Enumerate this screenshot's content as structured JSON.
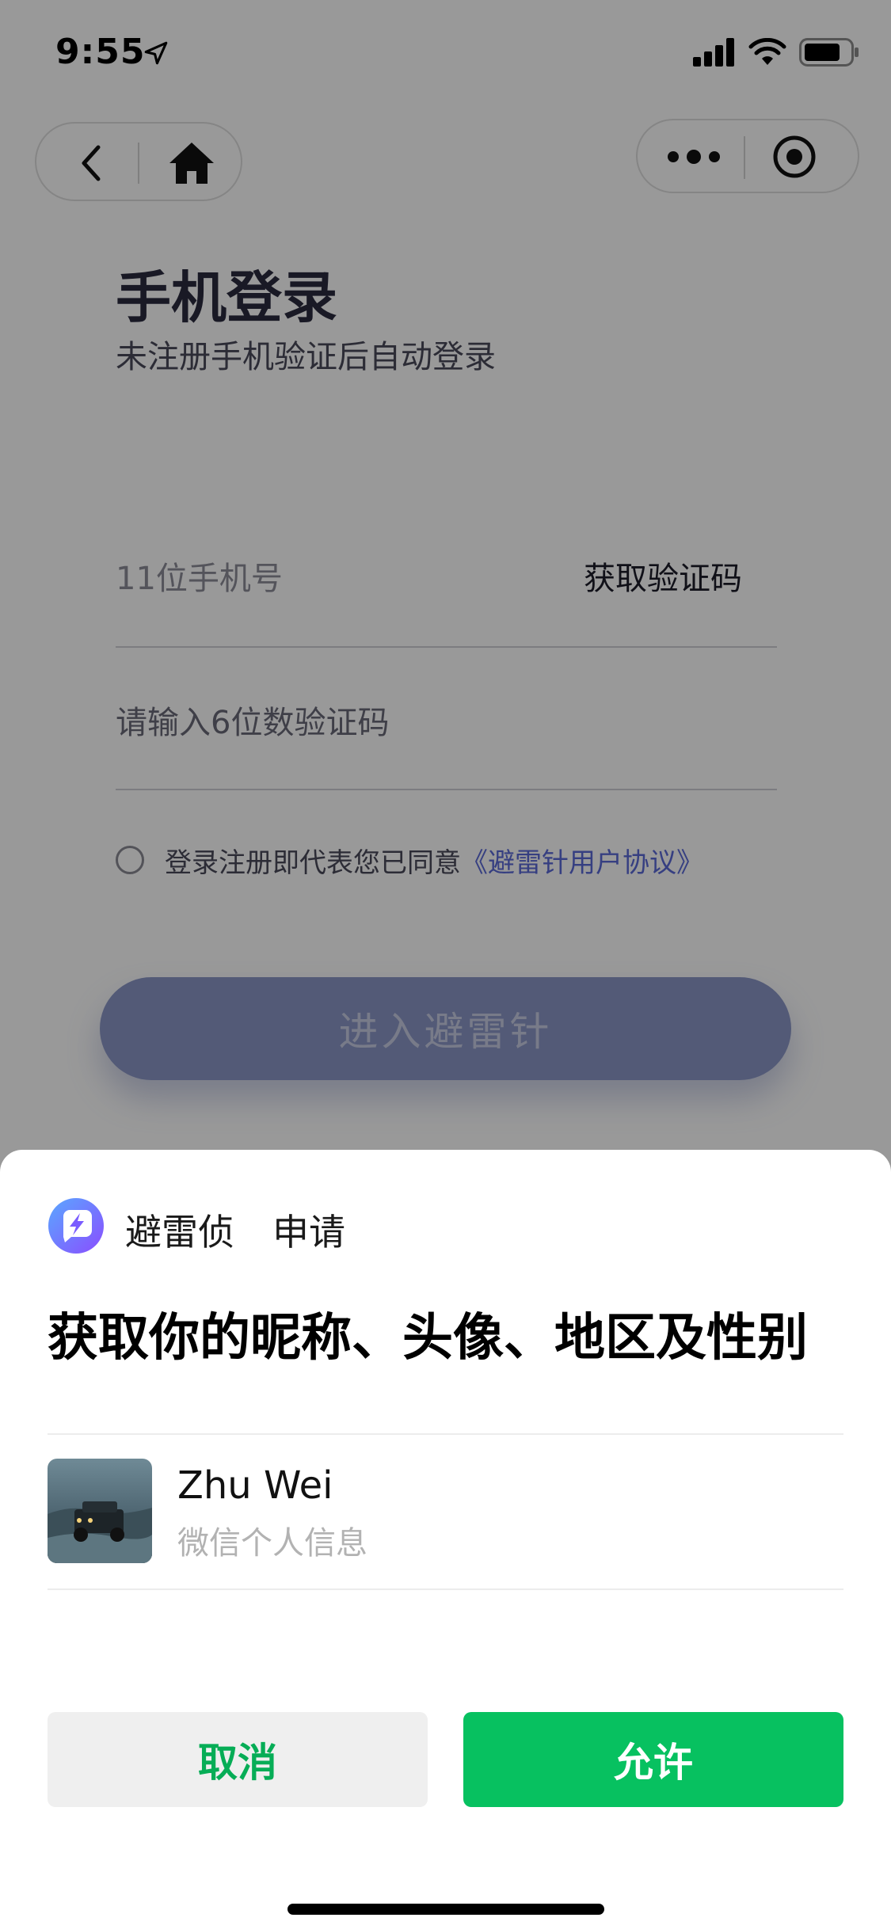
{
  "status_bar": {
    "time": "9:55",
    "icons": [
      "location-arrow-icon",
      "cellular-signal-icon",
      "wifi-icon",
      "battery-icon"
    ]
  },
  "nav": {
    "icons": [
      "back-icon",
      "home-icon",
      "more-icon",
      "target-icon"
    ]
  },
  "login": {
    "title": "手机登录",
    "subtitle": "未注册手机验证后自动登录",
    "phone_placeholder": "11位手机号",
    "get_code_label": "获取验证码",
    "code_placeholder": "请输入6位数验证码",
    "agreement_text": "登录注册即代表您已同意",
    "agreement_link": "《避雷针用户协议》",
    "enter_button": "进入避雷针"
  },
  "auth_sheet": {
    "app_name": "避雷侦",
    "apply_label": "申请",
    "request_text": "获取你的昵称、头像、地区及性别",
    "user": {
      "name": "Zhu Wei",
      "description": "微信个人信息"
    },
    "cancel_button": "取消",
    "allow_button": "允许"
  },
  "colors": {
    "accent_green": "#07c160",
    "cancel_text_green": "#06ad56",
    "link_blue": "#5a6ad8",
    "enter_button_bg": "#8b97c6"
  }
}
